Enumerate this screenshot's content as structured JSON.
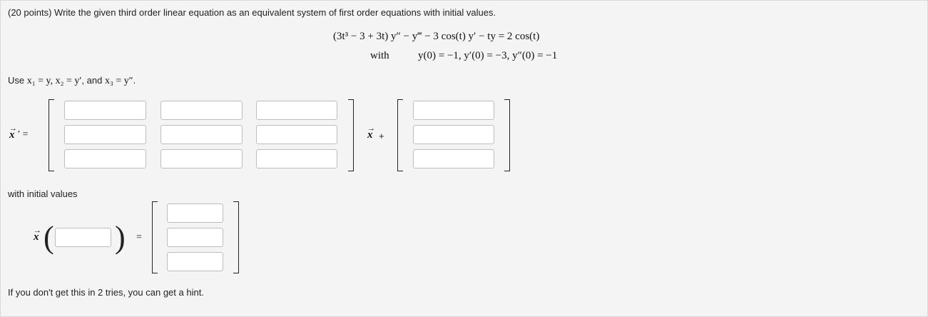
{
  "problem": {
    "statement": "(20 points) Write the given third order linear equation as an equivalent system of first order equations with initial values.",
    "equation": "(3t³ − 3 + 3t) y″ − y‴ − 3 cos(t) y′ − ty = 2 cos(t)",
    "with_label": "with",
    "initial_conditions": "y(0) = −1,  y′(0) = −3,  y″(0) = −1"
  },
  "substitution": {
    "prefix": "Use ",
    "vars": "x₁ = y, x₂ = y′",
    "conj": ", and ",
    "last": "x₃ = y″",
    "suffix": "."
  },
  "system": {
    "lhs_symbol": "x",
    "lhs_prime": "′ =",
    "matrix_rows": [
      [
        "",
        "",
        ""
      ],
      [
        "",
        "",
        ""
      ],
      [
        "",
        "",
        ""
      ]
    ],
    "times_symbol": "x",
    "plus_sign": "+",
    "forcing": [
      "",
      "",
      ""
    ]
  },
  "initial": {
    "label": "with initial values",
    "fn_symbol": "x",
    "t0_value": "",
    "equals": "=",
    "vector": [
      "",
      "",
      ""
    ]
  },
  "hint": "If you don't get this in 2 tries, you can get a hint."
}
